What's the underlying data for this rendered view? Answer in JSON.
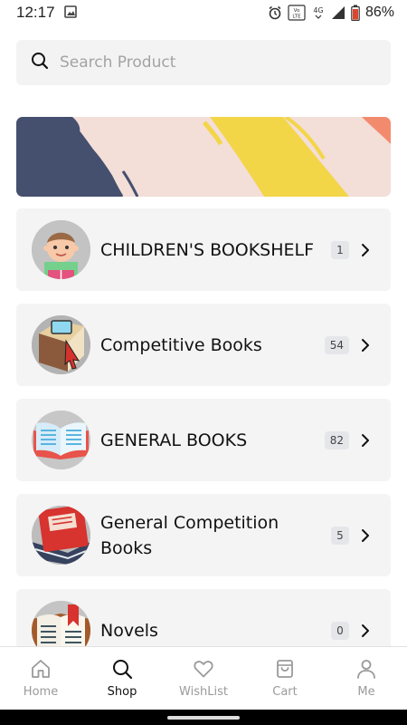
{
  "status_bar": {
    "time": "12:17",
    "network": "4G",
    "volte": "VoLTE",
    "battery": "86%"
  },
  "search": {
    "placeholder": "Search Product",
    "icon": "search-icon"
  },
  "banner": {
    "colors": [
      "#f3ded8",
      "#454f6e",
      "#f3d548",
      "#f28b6e"
    ]
  },
  "categories": [
    {
      "name": "CHILDREN'S BOOKSHELF",
      "count": "1",
      "icon": "child-reading-icon"
    },
    {
      "name": "Competitive Books",
      "count": "54",
      "icon": "book-cursor-icon"
    },
    {
      "name": "GENERAL BOOKS",
      "count": "82",
      "icon": "open-book-icon"
    },
    {
      "name": "General Competition Books",
      "count": "5",
      "icon": "book-stack-icon"
    },
    {
      "name": "Novels",
      "count": "0",
      "icon": "bookmark-book-icon"
    }
  ],
  "bottom_nav": {
    "items": [
      {
        "label": "Home",
        "icon": "home-icon",
        "active": false
      },
      {
        "label": "Shop",
        "icon": "search-icon",
        "active": true
      },
      {
        "label": "WishList",
        "icon": "heart-icon",
        "active": false
      },
      {
        "label": "Cart",
        "icon": "bag-icon",
        "active": false
      },
      {
        "label": "Me",
        "icon": "user-icon",
        "active": false
      }
    ]
  }
}
